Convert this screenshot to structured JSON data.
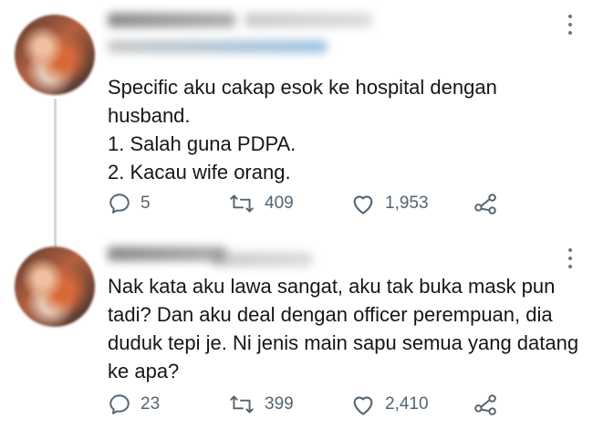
{
  "tweets": [
    {
      "text_lines": [
        "Specific aku cakap esok ke hospital dengan",
        "husband.",
        "1. Salah guna PDPA.",
        "2. Kacau wife orang."
      ],
      "replies": "5",
      "retweets": "409",
      "likes": "1,953",
      "icons": [
        "reply-icon",
        "retweet-icon",
        "like-icon",
        "share-icon",
        "more-icon"
      ]
    },
    {
      "text_lines": [
        "Nak kata aku lawa sangat, aku tak buka mask pun",
        "tadi? Dan aku deal dengan officer perempuan, dia",
        "duduk tepi je. Ni jenis main sapu semua yang datang",
        "ke apa?"
      ],
      "replies": "23",
      "retweets": "399",
      "likes": "2,410",
      "icons": [
        "reply-icon",
        "retweet-icon",
        "like-icon",
        "share-icon",
        "more-icon"
      ]
    }
  ],
  "colors": {
    "text": "#14171a",
    "secondary": "#536471",
    "thread": "#cfd9de"
  }
}
